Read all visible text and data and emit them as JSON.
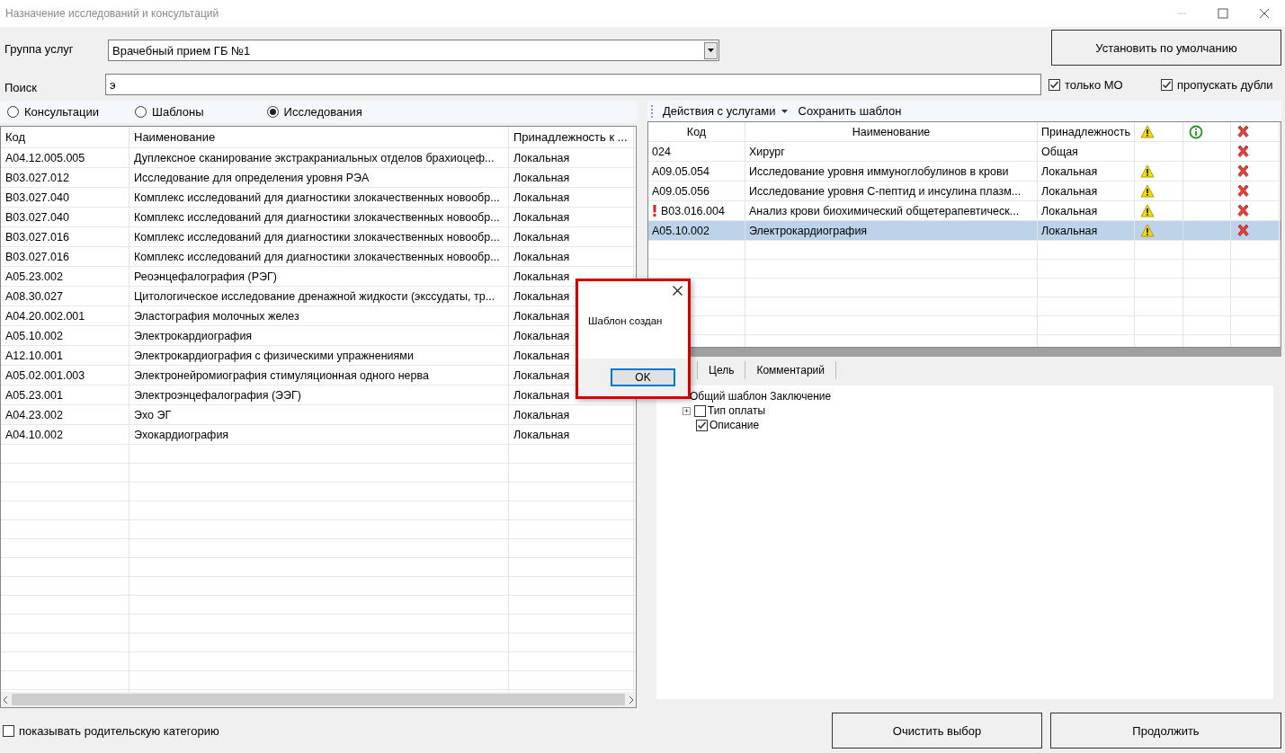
{
  "window": {
    "title": "Назначение исследований и консультаций"
  },
  "service_group": {
    "label": "Группа услуг",
    "value": "Врачебный прием ГБ №1"
  },
  "search": {
    "label": "Поиск",
    "value": "э"
  },
  "default_button": "Установить по умолчанию",
  "options": [
    {
      "label": "только МО",
      "checked": true
    },
    {
      "label": "пропускать дубли",
      "checked": true
    }
  ],
  "category_radios": [
    {
      "label": "Консультации",
      "selected": false
    },
    {
      "label": "Шаблоны",
      "selected": false
    },
    {
      "label": "Исследования",
      "selected": true
    }
  ],
  "services_table": {
    "columns": [
      "Код",
      "Наименование",
      "Принадлежность к ..."
    ],
    "rows": [
      [
        "A04.12.005.005",
        "Дуплексное сканирование экстракраниальных отделов брахиоцеф...",
        "Локальная"
      ],
      [
        "B03.027.012",
        "Исследование для определения уровня РЭА",
        "Локальная"
      ],
      [
        "B03.027.040",
        "Комплекс исследований для диагностики злокачественных новообр...",
        "Локальная"
      ],
      [
        "B03.027.040",
        "Комплекс исследований для диагностики злокачественных новообр...",
        "Локальная"
      ],
      [
        "B03.027.016",
        "Комплекс исследований для диагностики злокачественных новообр...",
        "Локальная"
      ],
      [
        "B03.027.016",
        "Комплекс исследований для диагностики злокачественных новообр...",
        "Локальная"
      ],
      [
        "A05.23.002",
        "Реоэнцефалография (РЭГ)",
        "Локальная"
      ],
      [
        "A08.30.027",
        "Цитологическое исследование дренажной жидкости (экссудаты, тр...",
        "Локальная"
      ],
      [
        "A04.20.002.001",
        "Эластография молочных желез",
        "Локальная"
      ],
      [
        "A05.10.002",
        "Электрокардиография",
        "Локальная"
      ],
      [
        "A12.10.001",
        "Электрокардиография с физическими упражнениями",
        "Локальная"
      ],
      [
        "A05.02.001.003",
        "Электронейромиография стимуляционная одного нерва",
        "Локальная"
      ],
      [
        "A05.23.001",
        "Электроэнцефалография (ЭЭГ)",
        "Локальная"
      ],
      [
        "A04.23.002",
        "Эхо ЭГ",
        "Локальная"
      ],
      [
        "A04.10.002",
        "Эхокардиография",
        "Локальная"
      ]
    ]
  },
  "toolbar": [
    {
      "label": "Действия с услугами",
      "kind": "dropdown"
    },
    {
      "label": "Сохранить шаблон",
      "kind": "button"
    }
  ],
  "selected_table": {
    "columns": [
      "Код",
      "Наименование",
      "Принадлежность"
    ],
    "rows": [
      {
        "code": "024",
        "name": "Хирург",
        "belongs": "Общая",
        "warning": false,
        "alert": false,
        "selected": false
      },
      {
        "code": "A09.05.054",
        "name": "Исследование уровня иммуноглобулинов в крови",
        "belongs": "Локальная",
        "warning": true,
        "alert": false,
        "selected": false
      },
      {
        "code": "A09.05.056",
        "name": "Исследование уровня С-пептид и инсулина плазм...",
        "belongs": "Локальная",
        "warning": true,
        "alert": false,
        "selected": false
      },
      {
        "code": "B03.016.004",
        "name": "Анализ крови биохимический общетерапевтическ...",
        "belongs": "Локальная",
        "warning": true,
        "alert": true,
        "selected": false
      },
      {
        "code": "A05.10.002",
        "name": "Электрокардиография",
        "belongs": "Локальная",
        "warning": true,
        "alert": false,
        "selected": true
      }
    ]
  },
  "detail_tabs": [
    {
      "label": "Цель",
      "selected": false
    },
    {
      "label": "Комментарий",
      "selected": false
    }
  ],
  "tree": [
    {
      "label": "Общий шаблон Заключение",
      "children": [
        {
          "label": "Тип оплаты",
          "checked": false,
          "expanded": false
        },
        {
          "label": "Описание",
          "checked": true
        }
      ]
    }
  ],
  "show_parent": {
    "label": "показывать родительскую категорию",
    "checked": false
  },
  "buttons": [
    "Очистить выбор",
    "Продолжить"
  ],
  "dialog": {
    "message": "Шаблон создан",
    "button": "OK"
  }
}
